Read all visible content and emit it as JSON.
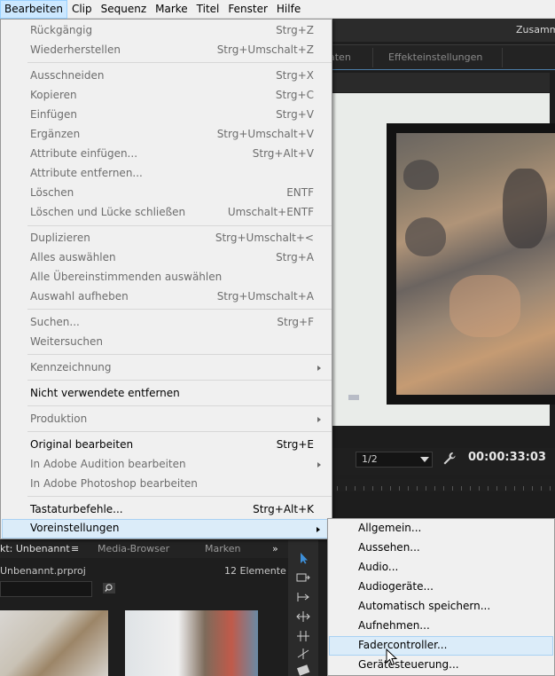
{
  "menubar": {
    "items": [
      "Bearbeiten",
      "Clip",
      "Sequenz",
      "Marke",
      "Titel",
      "Fenster",
      "Hilfe"
    ],
    "active_index": 0
  },
  "workspace": {
    "label": "Zusamm"
  },
  "panel_tabs": [
    "aten",
    "Effekteinstellungen"
  ],
  "program_monitor": {
    "resolution": "1/2",
    "timecode": "00:00:33:03"
  },
  "edit_menu": {
    "items": [
      {
        "label": "Rückgängig",
        "shortcut": "Strg+Z",
        "enabled": false
      },
      {
        "label": "Wiederherstellen",
        "shortcut": "Strg+Umschalt+Z",
        "enabled": false
      },
      {
        "label": "Ausschneiden",
        "shortcut": "Strg+X",
        "enabled": false
      },
      {
        "label": "Kopieren",
        "shortcut": "Strg+C",
        "enabled": false
      },
      {
        "label": "Einfügen",
        "shortcut": "Strg+V",
        "enabled": false
      },
      {
        "label": "Ergänzen",
        "shortcut": "Strg+Umschalt+V",
        "enabled": false
      },
      {
        "label": "Attribute einfügen...",
        "shortcut": "Strg+Alt+V",
        "enabled": false
      },
      {
        "label": "Attribute entfernen...",
        "shortcut": "",
        "enabled": false
      },
      {
        "label": "Löschen",
        "shortcut": "ENTF",
        "enabled": false
      },
      {
        "label": "Löschen und Lücke schließen",
        "shortcut": "Umschalt+ENTF",
        "enabled": false
      },
      {
        "label": "Duplizieren",
        "shortcut": "Strg+Umschalt+<",
        "enabled": false
      },
      {
        "label": "Alles auswählen",
        "shortcut": "Strg+A",
        "enabled": false
      },
      {
        "label": "Alle Übereinstimmenden auswählen",
        "shortcut": "",
        "enabled": false
      },
      {
        "label": "Auswahl aufheben",
        "shortcut": "Strg+Umschalt+A",
        "enabled": false
      },
      {
        "label": "Suchen...",
        "shortcut": "Strg+F",
        "enabled": false
      },
      {
        "label": "Weitersuchen",
        "shortcut": "",
        "enabled": false
      },
      {
        "label": "Kennzeichnung",
        "shortcut": "",
        "enabled": false,
        "submenu": true
      },
      {
        "label": "Nicht verwendete entfernen",
        "shortcut": "",
        "enabled": true
      },
      {
        "label": "Produktion",
        "shortcut": "",
        "enabled": false,
        "submenu": true
      },
      {
        "label": "Original bearbeiten",
        "shortcut": "Strg+E",
        "enabled": true
      },
      {
        "label": "In Adobe Audition bearbeiten",
        "shortcut": "",
        "enabled": false,
        "submenu": true
      },
      {
        "label": "In Adobe Photoshop bearbeiten",
        "shortcut": "",
        "enabled": false
      },
      {
        "label": "Tastaturbefehle...",
        "shortcut": "Strg+Alt+K",
        "enabled": true
      },
      {
        "label": "Voreinstellungen",
        "shortcut": "",
        "enabled": true,
        "submenu": true,
        "highlighted": true
      }
    ]
  },
  "prefs_submenu": {
    "items": [
      "Allgemein...",
      "Aussehen...",
      "Audio...",
      "Audiogeräte...",
      "Automatisch speichern...",
      "Aufnehmen...",
      "Fadercontroller...",
      "Gerätesteuerung..."
    ],
    "highlighted_index": 6
  },
  "project_panel": {
    "tabs": [
      "kt: Unbenannt",
      "Media-Browser",
      "Marken"
    ],
    "file_name": "Unbenannt.prproj",
    "item_count": "12 Elemente"
  }
}
